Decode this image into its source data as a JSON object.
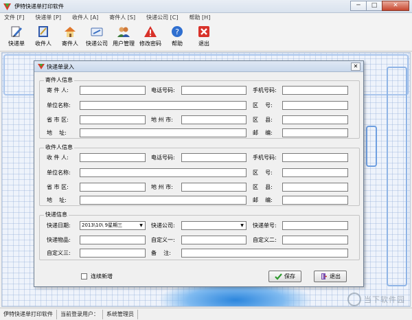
{
  "window": {
    "title": "伊特快递单打印软件",
    "controls": {
      "minimize": "─",
      "maximize": "□",
      "close": "✕"
    }
  },
  "menubar": {
    "items": [
      "文件 [F]",
      "快递单 [P]",
      "收件人 [A]",
      "寄件人 [S]",
      "快递公司 [C]",
      "帮助 [H]"
    ]
  },
  "toolbar": {
    "items": [
      {
        "label": "快递单",
        "icon": "edit-pen-icon"
      },
      {
        "label": "收件人",
        "icon": "notebook-icon"
      },
      {
        "label": "寄件人",
        "icon": "house-icon"
      },
      {
        "label": "快递公司",
        "icon": "card-icon"
      },
      {
        "label": "用户管理",
        "icon": "users-icon"
      },
      {
        "label": "修改密码",
        "icon": "warning-triangle-icon"
      },
      {
        "label": "帮助",
        "icon": "help-icon"
      },
      {
        "label": "退出",
        "icon": "exit-icon"
      }
    ]
  },
  "dialog": {
    "title": "快递单录入",
    "close": "✕",
    "sender": {
      "title": "寄件人信息",
      "name_label": "寄 件 人:",
      "phone_label": "电话号码:",
      "mobile_label": "手机号码:",
      "company_label": "单位名称:",
      "zone_label": "区    号:",
      "province_label": "省 市 区:",
      "city_label": "地 州 市:",
      "county_label": "区    县:",
      "address_label": "地    址:",
      "postcode_label": "邮    编:"
    },
    "receiver": {
      "title": "收件人信息",
      "name_label": "收 件 人:",
      "phone_label": "电话号码:",
      "mobile_label": "手机号码:",
      "company_label": "单位名称:",
      "zone_label": "区    号:",
      "province_label": "省 市 区:",
      "city_label": "地 州 市:",
      "county_label": "区    县:",
      "address_label": "地    址:",
      "postcode_label": "邮    编:"
    },
    "express": {
      "title": "快递信息",
      "date_label": "快递日期:",
      "date_value": "2013\\10\\ 9星期三",
      "company_label": "快递公司:",
      "company_value": "",
      "number_label": "快递单号:",
      "goods_label": "快递物品:",
      "custom1_label": "自定义一:",
      "custom2_label": "自定义二:",
      "custom3_label": "自定义三:",
      "remark_label": "备    注:"
    },
    "continuous_label": "连续新增",
    "continuous_checked": false,
    "save_label": "保存",
    "exit_label": "退出"
  },
  "statusbar": {
    "app_name": "伊特快递单打印软件",
    "current_user_label": "当前登录用户：",
    "current_user": "系统管理员"
  },
  "watermark": "当下软件园",
  "colors": {
    "canvas": "#eef3fb",
    "grid": "#8caad7",
    "accent_blue": "#2c86dd"
  }
}
